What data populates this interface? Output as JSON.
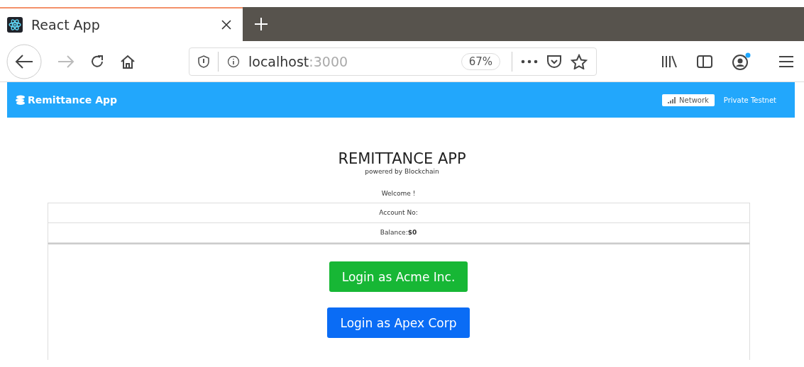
{
  "browser": {
    "tab": {
      "title": "React App",
      "selected": true
    },
    "url_host": "localhost",
    "url_port": ":3000",
    "zoom": "67%"
  },
  "navbar": {
    "brand": "Remittance App",
    "network_label": "Network",
    "network_name": "Private Testnet"
  },
  "header": {
    "title": "REMITTANCE APP",
    "subtitle": "powered by Blockchain"
  },
  "info_rows": [
    {
      "text": "Welcome !"
    },
    {
      "text": "Account No:"
    },
    {
      "text": "Balance:**$0**"
    }
  ],
  "buttons": [
    {
      "label": "Login as Acme Inc.",
      "color": "#17b735"
    },
    {
      "label": "Login as Apex Corp",
      "color": "#0a6cf5"
    }
  ]
}
